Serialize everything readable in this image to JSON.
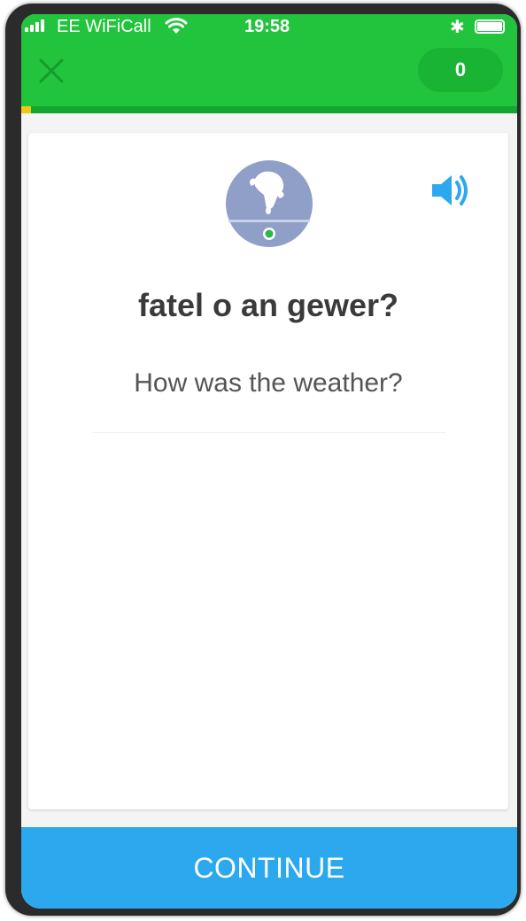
{
  "status_bar": {
    "carrier": "EE WiFiCall",
    "time": "19:58"
  },
  "header": {
    "score": "0",
    "progress_percent": 2
  },
  "card": {
    "prompt": "fatel o an gewer?",
    "translation": "How was the weather?"
  },
  "footer": {
    "continue_label": "CONTINUE"
  },
  "icons": {
    "close": "close-icon",
    "speaker": "speaker-icon",
    "memory": "memory-hand-icon",
    "wifi": "wifi-icon",
    "bluetooth": "bluetooth-icon",
    "battery": "battery-icon",
    "signal": "signal-icon"
  },
  "colors": {
    "header_green": "#21c43c",
    "progress_track": "#13a52e",
    "progress_fill": "#f3c612",
    "continue_blue": "#2ba8ee",
    "speaker_blue": "#2ba8ee"
  }
}
